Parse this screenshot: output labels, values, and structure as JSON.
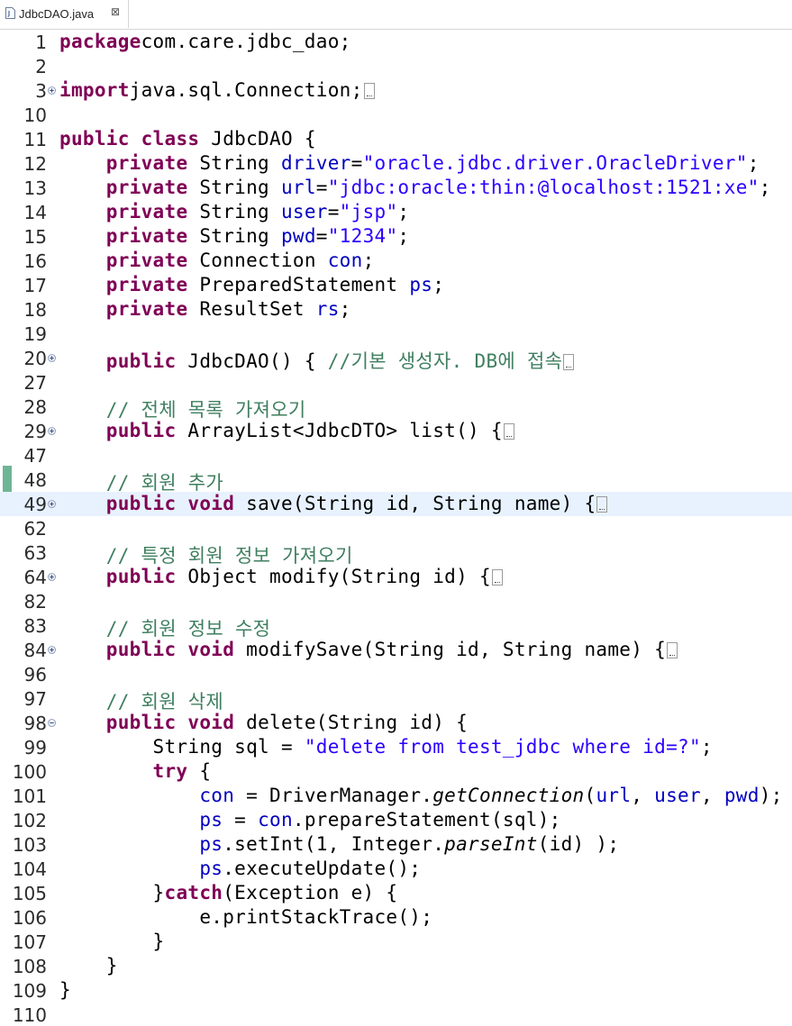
{
  "tab": {
    "label": "JdbcDAO.java",
    "close_glyph": "⊠",
    "icon": "java-file-icon"
  },
  "lines": [
    {
      "n": "1",
      "fold": "",
      "hl": false,
      "parts": [
        [
          "kw",
          "package"
        ],
        [
          "",
          "com.care.jdbc_dao;"
        ]
      ]
    },
    {
      "n": "2",
      "fold": "",
      "hl": false,
      "parts": []
    },
    {
      "n": "3",
      "fold": "expand",
      "hl": false,
      "parts": [
        [
          "kw",
          "import"
        ],
        [
          "",
          "java.sql.Connection;"
        ],
        [
          "box",
          ""
        ]
      ]
    },
    {
      "n": "10",
      "fold": "",
      "hl": false,
      "parts": []
    },
    {
      "n": "11",
      "fold": "",
      "hl": false,
      "parts": [
        [
          "kw",
          "public"
        ],
        [
          "",
          " "
        ],
        [
          "kw",
          "class"
        ],
        [
          "",
          " JdbcDAO {"
        ]
      ]
    },
    {
      "n": "12",
      "fold": "",
      "hl": false,
      "parts": [
        [
          "",
          "    "
        ],
        [
          "kw",
          "private"
        ],
        [
          "",
          " String "
        ],
        [
          "fld",
          "driver"
        ],
        [
          "",
          "="
        ],
        [
          "str",
          "\"oracle.jdbc.driver.OracleDriver\""
        ],
        [
          "",
          ";"
        ]
      ]
    },
    {
      "n": "13",
      "fold": "",
      "hl": false,
      "parts": [
        [
          "",
          "    "
        ],
        [
          "kw",
          "private"
        ],
        [
          "",
          " String "
        ],
        [
          "fld",
          "url"
        ],
        [
          "",
          "="
        ],
        [
          "str",
          "\"jdbc:oracle:thin:@localhost:1521:xe\""
        ],
        [
          "",
          ";"
        ]
      ]
    },
    {
      "n": "14",
      "fold": "",
      "hl": false,
      "parts": [
        [
          "",
          "    "
        ],
        [
          "kw",
          "private"
        ],
        [
          "",
          " String "
        ],
        [
          "fld",
          "user"
        ],
        [
          "",
          "="
        ],
        [
          "str",
          "\"jsp\""
        ],
        [
          "",
          ";"
        ]
      ]
    },
    {
      "n": "15",
      "fold": "",
      "hl": false,
      "parts": [
        [
          "",
          "    "
        ],
        [
          "kw",
          "private"
        ],
        [
          "",
          " String "
        ],
        [
          "fld",
          "pwd"
        ],
        [
          "",
          "="
        ],
        [
          "str",
          "\"1234\""
        ],
        [
          "",
          ";"
        ]
      ]
    },
    {
      "n": "16",
      "fold": "",
      "hl": false,
      "parts": [
        [
          "",
          "    "
        ],
        [
          "kw",
          "private"
        ],
        [
          "",
          " Connection "
        ],
        [
          "fld",
          "con"
        ],
        [
          "",
          ";"
        ]
      ]
    },
    {
      "n": "17",
      "fold": "",
      "hl": false,
      "parts": [
        [
          "",
          "    "
        ],
        [
          "kw",
          "private"
        ],
        [
          "",
          " PreparedStatement "
        ],
        [
          "fld",
          "ps"
        ],
        [
          "",
          ";"
        ]
      ]
    },
    {
      "n": "18",
      "fold": "",
      "hl": false,
      "parts": [
        [
          "",
          "    "
        ],
        [
          "kw",
          "private"
        ],
        [
          "",
          " ResultSet "
        ],
        [
          "fld",
          "rs"
        ],
        [
          "",
          ";"
        ]
      ]
    },
    {
      "n": "19",
      "fold": "",
      "hl": false,
      "parts": []
    },
    {
      "n": "20",
      "fold": "expand",
      "hl": false,
      "parts": [
        [
          "",
          "    "
        ],
        [
          "kw",
          "public"
        ],
        [
          "",
          " JdbcDAO() { "
        ],
        [
          "cmt",
          "//기본 생성자. DB에 접속"
        ],
        [
          "box",
          ""
        ]
      ]
    },
    {
      "n": "27",
      "fold": "",
      "hl": false,
      "parts": []
    },
    {
      "n": "28",
      "fold": "",
      "hl": false,
      "parts": [
        [
          "",
          "    "
        ],
        [
          "cmt",
          "// 전체 목록 가져오기"
        ]
      ]
    },
    {
      "n": "29",
      "fold": "expand",
      "hl": false,
      "parts": [
        [
          "",
          "    "
        ],
        [
          "kw",
          "public"
        ],
        [
          "",
          " ArrayList<JdbcDTO> list() {"
        ],
        [
          "box",
          ""
        ]
      ]
    },
    {
      "n": "47",
      "fold": "",
      "hl": false,
      "parts": []
    },
    {
      "n": "48",
      "fold": "",
      "hl": false,
      "parts": [
        [
          "",
          "    "
        ],
        [
          "cmt",
          "// 회원 추가"
        ]
      ]
    },
    {
      "n": "49",
      "fold": "expand",
      "hl": true,
      "parts": [
        [
          "",
          "    "
        ],
        [
          "kw",
          "public"
        ],
        [
          "",
          " "
        ],
        [
          "kw",
          "void"
        ],
        [
          "",
          " save(String id, String name) {"
        ],
        [
          "box",
          ""
        ]
      ]
    },
    {
      "n": "62",
      "fold": "",
      "hl": false,
      "parts": []
    },
    {
      "n": "63",
      "fold": "",
      "hl": false,
      "parts": [
        [
          "",
          "    "
        ],
        [
          "cmt",
          "// 특정 회원 정보 가져오기"
        ]
      ]
    },
    {
      "n": "64",
      "fold": "expand",
      "hl": false,
      "parts": [
        [
          "",
          "    "
        ],
        [
          "kw",
          "public"
        ],
        [
          "",
          " Object modify(String id) {"
        ],
        [
          "box",
          ""
        ]
      ]
    },
    {
      "n": "82",
      "fold": "",
      "hl": false,
      "parts": []
    },
    {
      "n": "83",
      "fold": "",
      "hl": false,
      "parts": [
        [
          "",
          "    "
        ],
        [
          "cmt",
          "// 회원 정보 수정"
        ]
      ]
    },
    {
      "n": "84",
      "fold": "expand",
      "hl": false,
      "parts": [
        [
          "",
          "    "
        ],
        [
          "kw",
          "public"
        ],
        [
          "",
          " "
        ],
        [
          "kw",
          "void"
        ],
        [
          "",
          " modifySave(String id, String name) {"
        ],
        [
          "box",
          ""
        ]
      ]
    },
    {
      "n": "96",
      "fold": "",
      "hl": false,
      "parts": []
    },
    {
      "n": "97",
      "fold": "",
      "hl": false,
      "parts": [
        [
          "",
          "    "
        ],
        [
          "cmt",
          "// 회원 삭제"
        ]
      ]
    },
    {
      "n": "98",
      "fold": "collapse",
      "hl": false,
      "parts": [
        [
          "",
          "    "
        ],
        [
          "kw",
          "public"
        ],
        [
          "",
          " "
        ],
        [
          "kw",
          "void"
        ],
        [
          "",
          " delete(String id) {"
        ]
      ]
    },
    {
      "n": "99",
      "fold": "",
      "hl": false,
      "parts": [
        [
          "",
          "        String "
        ],
        [
          "",
          "sql"
        ],
        [
          "",
          " = "
        ],
        [
          "str",
          "\"delete from test_jdbc where id=?\""
        ],
        [
          "",
          ";"
        ]
      ]
    },
    {
      "n": "100",
      "fold": "",
      "hl": false,
      "parts": [
        [
          "",
          "        "
        ],
        [
          "kw",
          "try"
        ],
        [
          "",
          " {"
        ]
      ]
    },
    {
      "n": "101",
      "fold": "",
      "hl": false,
      "parts": [
        [
          "",
          "            "
        ],
        [
          "fld",
          "con"
        ],
        [
          "",
          " = DriverManager."
        ],
        [
          "it",
          "getConnection"
        ],
        [
          "",
          "("
        ],
        [
          "fld",
          "url"
        ],
        [
          "",
          ", "
        ],
        [
          "fld",
          "user"
        ],
        [
          "",
          ", "
        ],
        [
          "fld",
          "pwd"
        ],
        [
          "",
          ");"
        ]
      ]
    },
    {
      "n": "102",
      "fold": "",
      "hl": false,
      "parts": [
        [
          "",
          "            "
        ],
        [
          "fld",
          "ps"
        ],
        [
          "",
          " = "
        ],
        [
          "fld",
          "con"
        ],
        [
          "",
          ".prepareStatement(sql);"
        ]
      ]
    },
    {
      "n": "103",
      "fold": "",
      "hl": false,
      "parts": [
        [
          "",
          "            "
        ],
        [
          "fld",
          "ps"
        ],
        [
          "",
          ".setInt(1, Integer."
        ],
        [
          "it",
          "parseInt"
        ],
        [
          "",
          "(id) );"
        ]
      ]
    },
    {
      "n": "104",
      "fold": "",
      "hl": false,
      "parts": [
        [
          "",
          "            "
        ],
        [
          "fld",
          "ps"
        ],
        [
          "",
          ".executeUpdate();"
        ]
      ]
    },
    {
      "n": "105",
      "fold": "",
      "hl": false,
      "parts": [
        [
          "",
          "        }"
        ],
        [
          "kw",
          "catch"
        ],
        [
          "",
          "(Exception e) {"
        ]
      ]
    },
    {
      "n": "106",
      "fold": "",
      "hl": false,
      "parts": [
        [
          "",
          "            e.printStackTrace();"
        ]
      ]
    },
    {
      "n": "107",
      "fold": "",
      "hl": false,
      "parts": [
        [
          "",
          "        }"
        ]
      ]
    },
    {
      "n": "108",
      "fold": "",
      "hl": false,
      "parts": [
        [
          "",
          "    }"
        ]
      ]
    },
    {
      "n": "109",
      "fold": "",
      "hl": false,
      "parts": [
        [
          "",
          "}"
        ]
      ]
    },
    {
      "n": "110",
      "fold": "",
      "hl": false,
      "parts": []
    }
  ],
  "colors": {
    "keyword": "#7f0055",
    "string": "#2a00ff",
    "field": "#0000c0",
    "comment": "#3f7f5f",
    "current_line": "#e8f2fe",
    "change_bar": "#4aa37a"
  }
}
